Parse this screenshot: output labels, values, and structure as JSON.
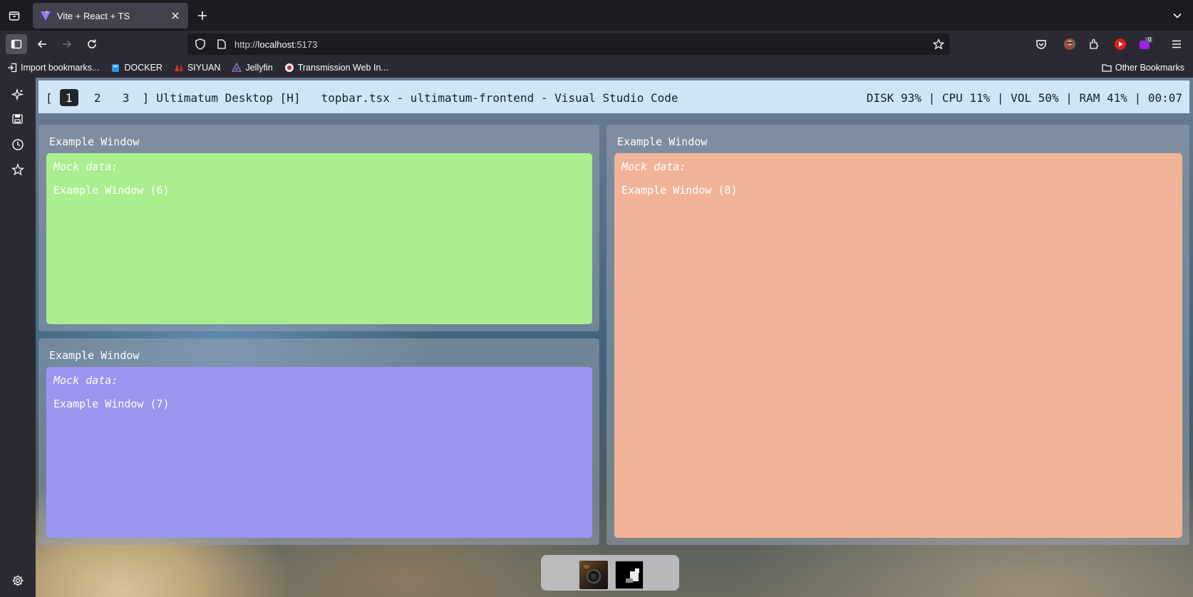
{
  "browser": {
    "tab_title": "Vite + React + TS",
    "url_prefix": "http://",
    "url_host": "localhost",
    "url_port": ":5173",
    "extension_badge": "0"
  },
  "bookmarks": [
    {
      "label": "Import bookmarks...",
      "icon": "import-icon"
    },
    {
      "label": "DOCKER",
      "icon": "docker-icon"
    },
    {
      "label": "SIYUAN",
      "icon": "siyuan-icon"
    },
    {
      "label": "Jellyfin",
      "icon": "jellyfin-icon"
    },
    {
      "label": "Transmission Web In...",
      "icon": "transmission-icon"
    }
  ],
  "other_bookmarks": "Other Bookmarks",
  "topbar": {
    "open_bracket": "[",
    "workspaces": [
      "1",
      "2",
      "3"
    ],
    "close_bracket": "]",
    "desktop_label": "Ultimatum Desktop [H]",
    "active_window": "topbar.tsx - ultimatum-frontend - Visual Studio Code",
    "status": "DISK 93% | CPU 11% | VOL 50% | RAM 41% | 00:07"
  },
  "windows": [
    {
      "title": "Example Window",
      "mock_label": "Mock data:",
      "content": "Example Window (6)",
      "color": "#abee8f"
    },
    {
      "title": "Example Window",
      "mock_label": "Mock data:",
      "content": "Example Window (7)",
      "color": "#9b95f0"
    },
    {
      "title": "Example Window",
      "mock_label": "Mock data:",
      "content": "Example Window (8)",
      "color": "#f1b398"
    }
  ],
  "dock": [
    "terminal-app-icon",
    "photo-app-icon"
  ]
}
